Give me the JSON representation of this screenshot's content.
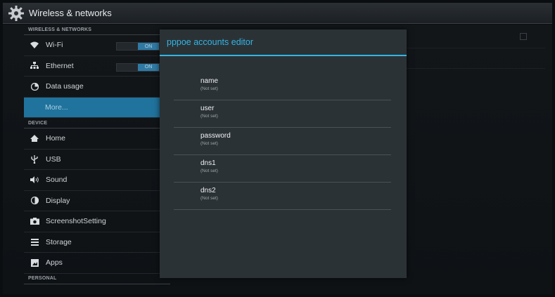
{
  "actionbar": {
    "title": "Wireless & networks"
  },
  "sidebar": {
    "sections": [
      {
        "header": "WIRELESS & NETWORKS"
      },
      {
        "header": "DEVICE"
      },
      {
        "header": "PERSONAL"
      }
    ],
    "items": [
      {
        "label": "Wi-Fi",
        "icon": "wifi-icon",
        "switch": "ON"
      },
      {
        "label": "Ethernet",
        "icon": "ethernet-icon",
        "switch": "ON"
      },
      {
        "label": "Data usage",
        "icon": "data-usage-icon"
      },
      {
        "label": "More...",
        "selected": true
      },
      {
        "label": "Home",
        "icon": "home-icon"
      },
      {
        "label": "USB",
        "icon": "usb-icon"
      },
      {
        "label": "Sound",
        "icon": "sound-icon"
      },
      {
        "label": "Display",
        "icon": "display-icon"
      },
      {
        "label": "ScreenshotSetting",
        "icon": "camera-icon"
      },
      {
        "label": "Storage",
        "icon": "storage-icon"
      },
      {
        "label": "Apps",
        "icon": "apps-icon"
      }
    ]
  },
  "dialog": {
    "title": "pppoe accounts editor",
    "fields": [
      {
        "name": "name",
        "value": "(Not set)"
      },
      {
        "name": "user",
        "value": "(Not set)"
      },
      {
        "name": "password",
        "value": "(Not set)"
      },
      {
        "name": "dns1",
        "value": "(Not set)"
      },
      {
        "name": "dns2",
        "value": "(Not set)"
      }
    ]
  },
  "colors": {
    "accent": "#33b5e5",
    "selected_bg": "#20739d",
    "dialog_bg": "#2b3236"
  }
}
